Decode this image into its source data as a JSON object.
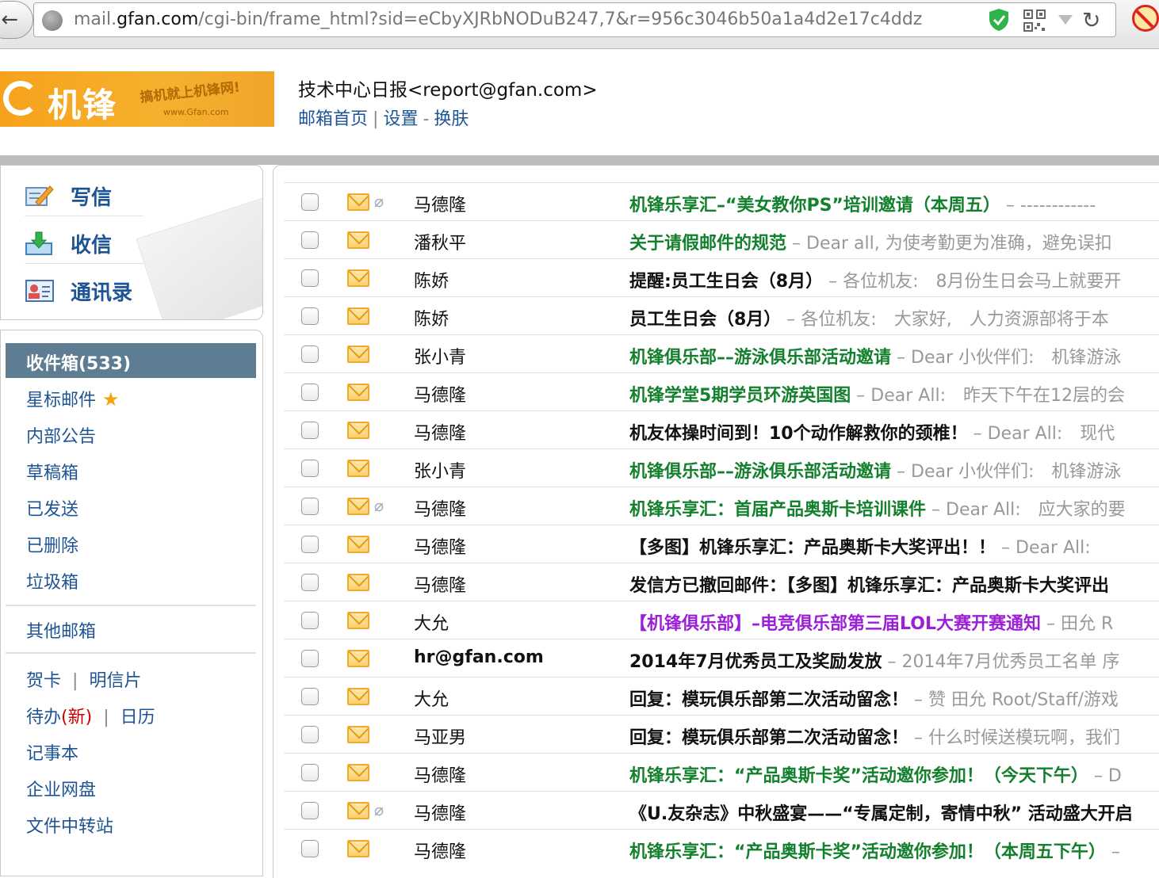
{
  "browser": {
    "url_prefix": "mail.",
    "url_domain": "gfan.com",
    "url_rest": "/cgi-bin/frame_html?sid=eCbyXJRbNODuB247,7&r=956c3046b50a1a4d2e17c4ddz"
  },
  "header": {
    "logo_main": "机锋",
    "logo_slogan": "搞机就上机锋网!",
    "logo_url": "www.Gfan.com",
    "account": "技术中心日报<report@gfan.com>",
    "link_home": "邮箱首页",
    "link_settings": "设置",
    "link_skin": "换肤"
  },
  "quick_actions": {
    "compose": "写信",
    "receive": "收信",
    "contacts": "通讯录"
  },
  "folders": {
    "inbox": "收件箱(533)",
    "starred": "星标邮件",
    "internal": "内部公告",
    "drafts": "草稿箱",
    "sent": "已发送",
    "deleted": "已删除",
    "spam": "垃圾箱",
    "other": "其他邮箱",
    "cards": "贺卡",
    "postcards": "明信片",
    "todo": "待办",
    "todo_new": "(新)",
    "calendar": "日历",
    "notes": "记事本",
    "disk": "企业网盘",
    "transfer": "文件中转站"
  },
  "mails": [
    {
      "sender": "马德隆",
      "subject": "机锋乐享汇–“美女教你PS”培训邀请（本周五）",
      "preview": " – ------------",
      "color": "green",
      "attach": true
    },
    {
      "sender": "潘秋平",
      "subject": "关于请假邮件的规范",
      "preview": " – Dear all, 为使考勤更为准确，避免误扣",
      "color": "green",
      "attach": false
    },
    {
      "sender": "陈娇",
      "subject": "提醒:员工生日会（8月）",
      "preview": " – 各位机友:　8月份生日会马上就要开",
      "color": "black",
      "attach": false
    },
    {
      "sender": "陈娇",
      "subject": "员工生日会（8月）",
      "preview": " – 各位机友:　大家好,　人力资源部将于本",
      "color": "black",
      "attach": false
    },
    {
      "sender": "张小青",
      "subject": "机锋俱乐部––游泳俱乐部活动邀请",
      "preview": " – Dear 小伙伴们:　机锋游泳",
      "color": "green",
      "attach": false
    },
    {
      "sender": "马德隆",
      "subject": "机锋学堂5期学员环游英国图",
      "preview": " – Dear All:　昨天下午在12层的会",
      "color": "green",
      "attach": false
    },
    {
      "sender": "马德隆",
      "subject": "机友体操时间到！10个动作解救你的颈椎！",
      "preview": " – Dear All:　现代",
      "color": "black",
      "attach": false
    },
    {
      "sender": "张小青",
      "subject": "机锋俱乐部––游泳俱乐部活动邀请",
      "preview": " – Dear 小伙伴们:　机锋游泳",
      "color": "green",
      "attach": false
    },
    {
      "sender": "马德隆",
      "subject": "机锋乐享汇：首届产品奥斯卡培训课件",
      "preview": " – Dear All:　应大家的要",
      "color": "green",
      "attach": true
    },
    {
      "sender": "马德隆",
      "subject": "【多图】机锋乐享汇：产品奥斯卡大奖评出！！",
      "preview": " – Dear All:　",
      "color": "black",
      "attach": false
    },
    {
      "sender": "马德隆",
      "subject": "发信方已撤回邮件：【多图】机锋乐享汇：产品奥斯卡大奖评出",
      "preview": "",
      "color": "black",
      "attach": false
    },
    {
      "sender": "大允",
      "subject": "【机锋俱乐部】–电竞俱乐部第三届LOL大赛开赛通知",
      "preview": " – 田允 R",
      "color": "purple",
      "attach": false
    },
    {
      "sender": "hr@gfan.com",
      "subject": "2014年7月优秀员工及奖励发放",
      "preview": " – 2014年7月优秀员工名单 序",
      "color": "black",
      "attach": false,
      "sender_bold": true
    },
    {
      "sender": "大允",
      "subject": "回复：模玩俱乐部第二次活动留念！",
      "preview": " – 赞 田允 Root/Staff/游戏",
      "color": "black",
      "attach": false
    },
    {
      "sender": "马亚男",
      "subject": "回复：模玩俱乐部第二次活动留念！",
      "preview": " – 什么时候送模玩啊，我们",
      "color": "black",
      "attach": false
    },
    {
      "sender": "马德隆",
      "subject": "机锋乐享汇：“产品奥斯卡奖”活动邀你参加！（今天下午）",
      "preview": " – D",
      "color": "green",
      "attach": false
    },
    {
      "sender": "马德隆",
      "subject": "《U.友杂志》中秋盛宴——“专属定制，寄情中秋” 活动盛大开启",
      "preview": "",
      "color": "black",
      "attach": true
    },
    {
      "sender": "马德隆",
      "subject": "机锋乐享汇：“产品奥斯卡奖”活动邀你参加！（本周五下午）",
      "preview": " –",
      "color": "green",
      "attach": false
    }
  ]
}
